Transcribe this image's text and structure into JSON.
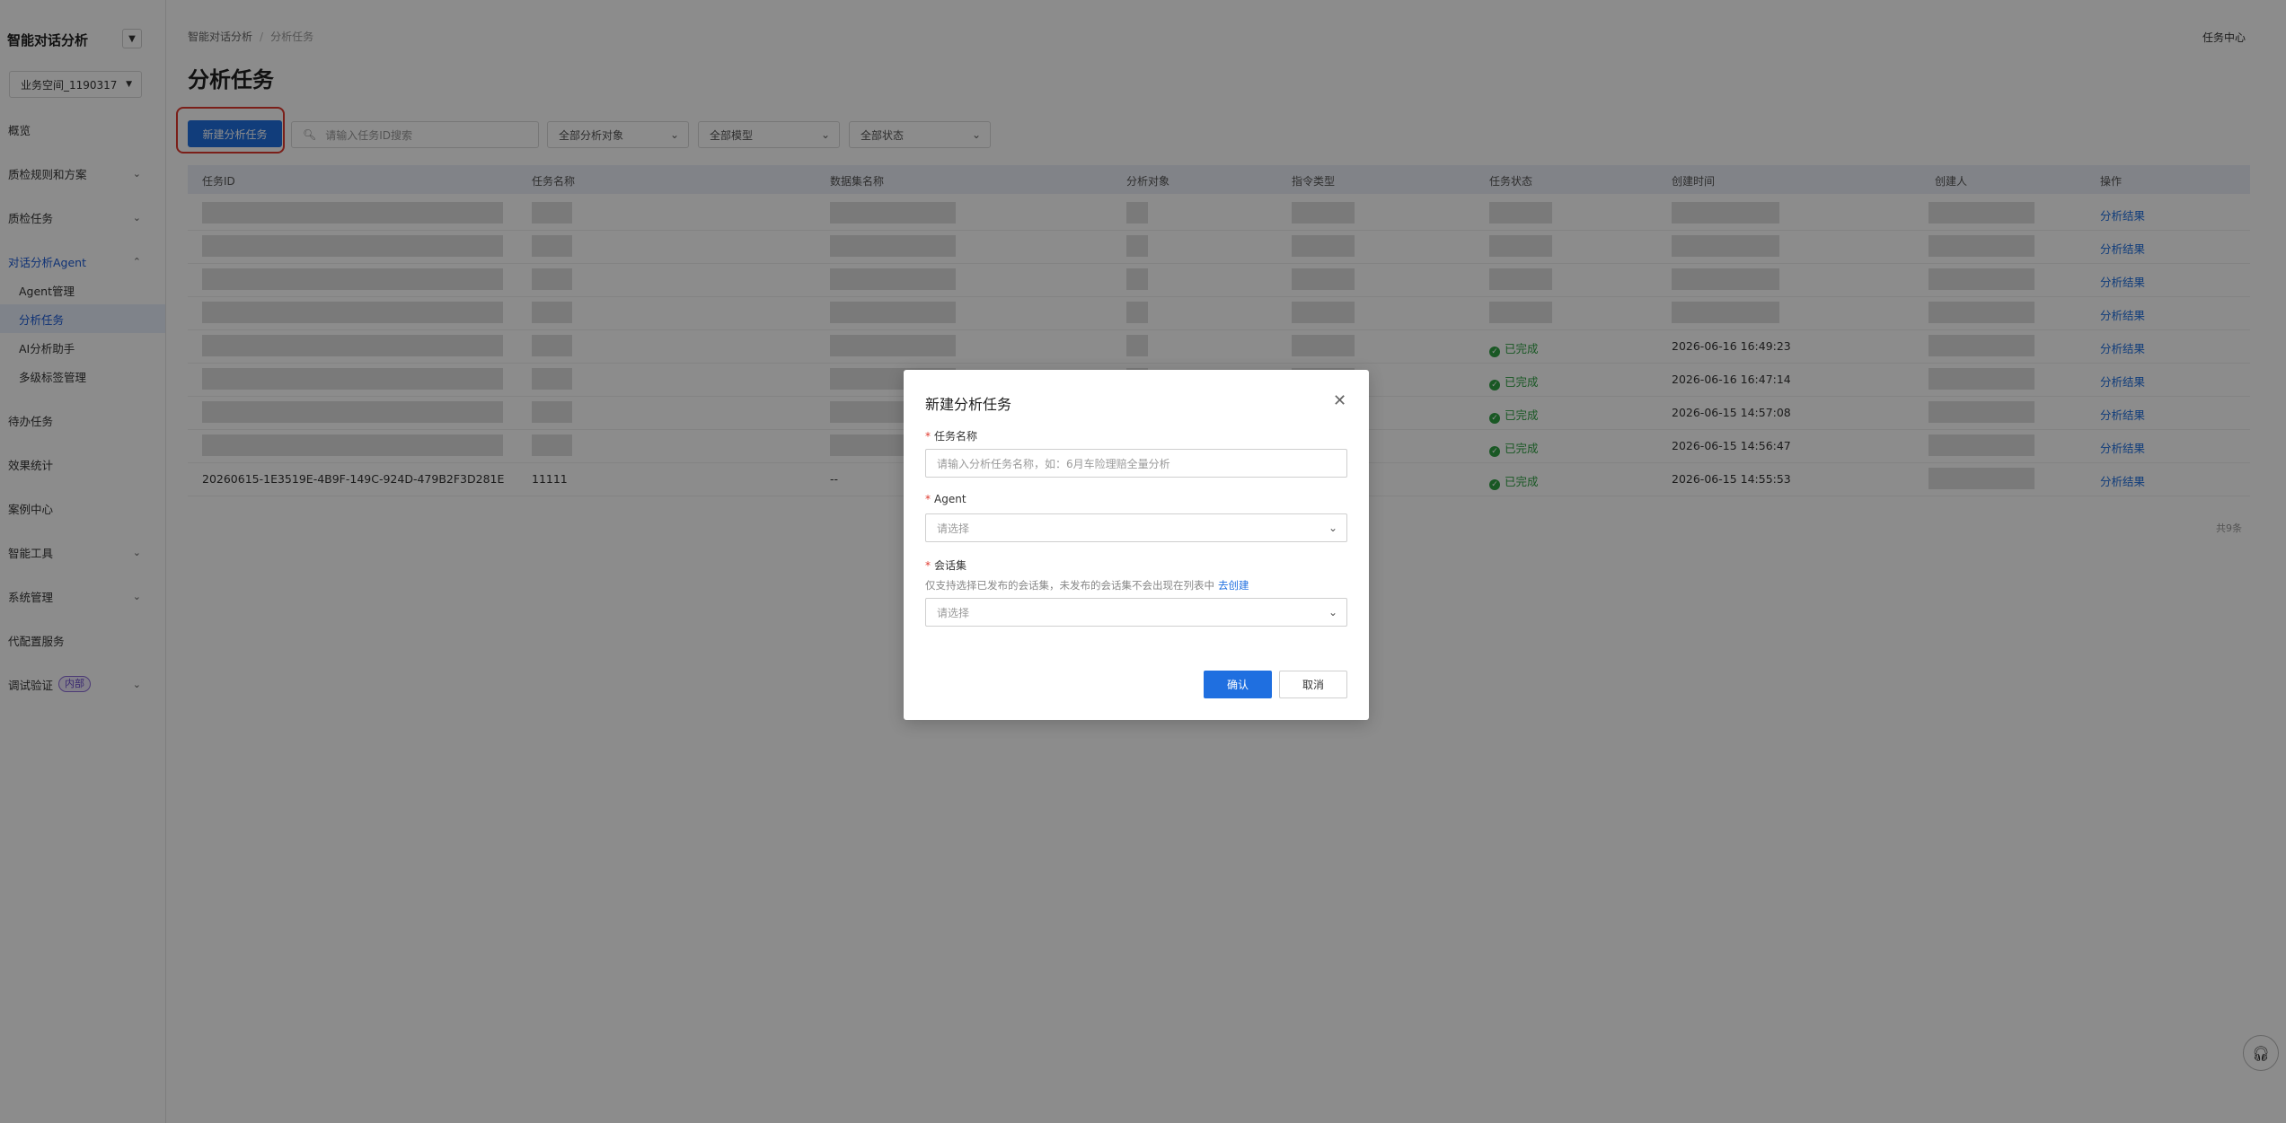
{
  "sidebar": {
    "brand": "智能对话分析",
    "workspace": "业务空间_1190317",
    "items": [
      {
        "label": "概览"
      },
      {
        "label": "质检规则和方案"
      },
      {
        "label": "质检任务"
      },
      {
        "label": "对话分析Agent"
      },
      {
        "label": "Agent管理"
      },
      {
        "label": "分析任务"
      },
      {
        "label": "AI分析助手"
      },
      {
        "label": "多级标签管理"
      },
      {
        "label": "待办任务"
      },
      {
        "label": "效果统计"
      },
      {
        "label": "案例中心"
      },
      {
        "label": "智能工具"
      },
      {
        "label": "系统管理"
      },
      {
        "label": "代配置服务"
      },
      {
        "label": "调试验证",
        "badge": "内部"
      }
    ]
  },
  "header": {
    "breadcrumb": [
      "智能对话分析",
      "分析任务"
    ],
    "task_center": "任务中心",
    "title": "分析任务"
  },
  "toolbar": {
    "new_task_label": "新建分析任务",
    "search_placeholder": "请输入任务ID搜索",
    "filters": [
      "全部分析对象",
      "全部模型",
      "全部状态"
    ]
  },
  "table": {
    "columns": [
      "任务ID",
      "任务名称",
      "数据集名称",
      "分析对象",
      "指令类型",
      "任务状态",
      "创建时间",
      "创建人",
      "操作"
    ],
    "rows": [
      {
        "id": "",
        "name": "",
        "dataset": "",
        "status": "",
        "created": "",
        "action": "分析结果"
      },
      {
        "id": "",
        "name": "",
        "dataset": "",
        "status": "",
        "created": "",
        "action": "分析结果"
      },
      {
        "id": "",
        "name": "",
        "dataset": "",
        "status": "",
        "created": "",
        "action": "分析结果"
      },
      {
        "id": "",
        "name": "",
        "dataset": "",
        "status": "",
        "created": "",
        "action": "分析结果"
      },
      {
        "id": "",
        "name": "",
        "dataset": "",
        "status": "已完成",
        "created": "2026-06-16 16:49:23",
        "action": "分析结果"
      },
      {
        "id": "",
        "name": "",
        "dataset": "",
        "status": "已完成",
        "created": "2026-06-16 16:47:14",
        "action": "分析结果"
      },
      {
        "id": "",
        "name": "",
        "dataset": "",
        "status": "已完成",
        "created": "2026-06-15 14:57:08",
        "action": "分析结果"
      },
      {
        "id": "",
        "name": "",
        "dataset": "",
        "status": "已完成",
        "created": "2026-06-15 14:56:47",
        "action": "分析结果"
      },
      {
        "id": "20260615-1E3519E-4B9F-149C-924D-479B2F3D281E",
        "name": "11111",
        "dataset": "--",
        "status": "已完成",
        "created": "2026-06-15 14:55:53",
        "action": "分析结果"
      }
    ],
    "total": "共9条"
  },
  "modal": {
    "title": "新建分析任务",
    "name_label": "任务名称",
    "name_placeholder": "请输入分析任务名称，如：6月车险理赔全量分析",
    "agent_label": "Agent",
    "agent_placeholder": "请选择",
    "session_label": "会话集",
    "session_hint": "仅支持选择已发布的会话集，未发布的会话集不会出现在列表中",
    "session_hint_link": "去创建",
    "session_placeholder": "请选择",
    "confirm_label": "确认",
    "cancel_label": "取消"
  }
}
